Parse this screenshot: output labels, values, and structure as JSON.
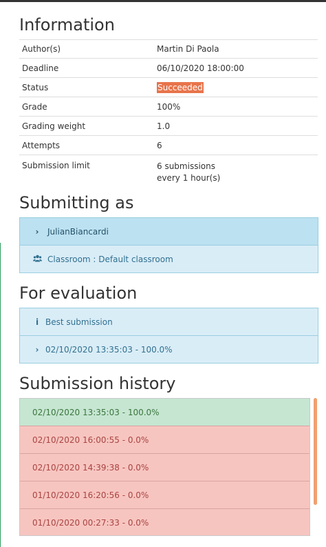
{
  "information": {
    "title": "Information",
    "rows": {
      "authors": {
        "label": "Author(s)",
        "value": "Martin Di Paola"
      },
      "deadline": {
        "label": "Deadline",
        "value": "06/10/2020 18:00:00"
      },
      "status": {
        "label": "Status",
        "value": "Succeeded"
      },
      "grade": {
        "label": "Grade",
        "value": "100%"
      },
      "weight": {
        "label": "Grading weight",
        "value": "1.0"
      },
      "attempts": {
        "label": "Attempts",
        "value": "6"
      },
      "limit": {
        "label": "Submission limit",
        "value_line1": "6 submissions",
        "value_line2": "every 1 hour(s)"
      }
    }
  },
  "submitting_as": {
    "title": "Submitting as",
    "user": "JulianBiancardi",
    "classroom": "Classroom : Default classroom"
  },
  "for_evaluation": {
    "title": "For evaluation",
    "best_label": "Best submission",
    "submission": "02/10/2020 13:35:03 - 100.0%"
  },
  "history": {
    "title": "Submission history",
    "items": [
      {
        "text": "02/10/2020 13:35:03 - 100.0%",
        "status": "success"
      },
      {
        "text": "02/10/2020 16:00:55 - 0.0%",
        "status": "fail"
      },
      {
        "text": "02/10/2020 14:39:38 - 0.0%",
        "status": "fail"
      },
      {
        "text": "01/10/2020 16:20:56 - 0.0%",
        "status": "fail"
      },
      {
        "text": "01/10/2020 00:27:33 - 0.0%",
        "status": "fail"
      }
    ]
  },
  "colors": {
    "status_badge": "#e8744b",
    "success_row": "#c6e6d2",
    "fail_row": "#f7c5c0",
    "info_panel": "#d9edf7"
  },
  "icons": {
    "chevron": "chevron-right-icon",
    "users": "users-icon",
    "info": "info-icon"
  }
}
